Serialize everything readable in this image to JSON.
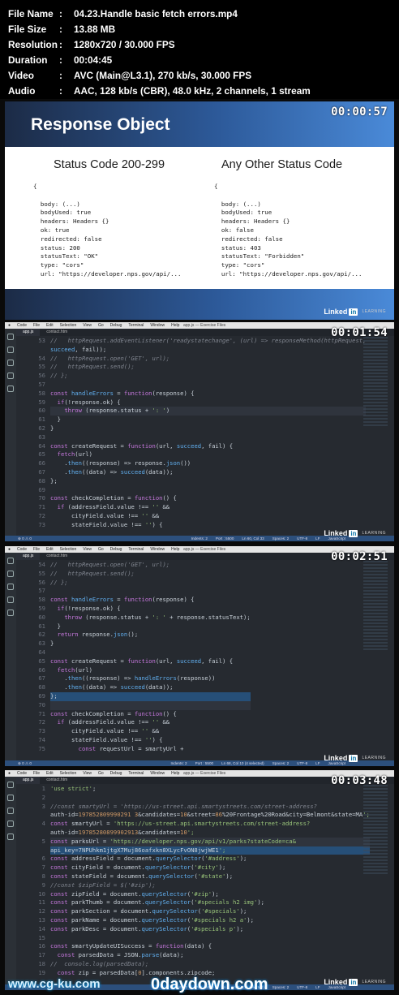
{
  "info": [
    {
      "label": "File Name",
      "value": "04.23.Handle basic fetch errors.mp4"
    },
    {
      "label": "File Size",
      "value": "13.88 MB"
    },
    {
      "label": "Resolution",
      "value": "1280x720 / 30.000 FPS"
    },
    {
      "label": "Duration",
      "value": "00:04:45"
    },
    {
      "label": "Video",
      "value": "AVC (Main@L3.1), 270 kb/s, 30.000 FPS"
    },
    {
      "label": "Audio",
      "value": "AAC, 128 kb/s (CBR), 48.0 kHz, 2 channels, 1 stream"
    }
  ],
  "colon": ":",
  "brand": {
    "linked": "Linked",
    "in": "in",
    "learning": "LEARNING"
  },
  "slide": {
    "timestamp": "00:00:57",
    "title": "Response Object",
    "left_heading": "Status Code 200-299",
    "right_heading": "Any Other Status Code",
    "left_code": "{\n\n  body: (...)\n  bodyUsed: true\n  headers: Headers {}\n  ok: true\n  redirected: false\n  status: 200\n  statusText: \"OK\"\n  type: \"cors\"\n  url: \"https://developer.nps.gov/api/...\n\n}",
    "right_code": "{\n\n  body: (...)\n  bodyUsed: true\n  headers: Headers {}\n  ok: false\n  redirected: false\n  status: 403\n  statusText: \"Forbidden\"\n  type: \"cors\"\n  url: \"https://developer.nps.gov/api/...\n\n}"
  },
  "editor": {
    "menu": [
      "Code",
      "File",
      "Edit",
      "Selection",
      "View",
      "Go",
      "Debug",
      "Terminal",
      "Window",
      "Help"
    ],
    "window_title": "app.js — Exercise Files",
    "tabs": [
      "app.js",
      "contact.htm"
    ]
  },
  "frames": [
    {
      "timestamp": "00:01:54",
      "lines": [
        {
          "n": "53",
          "t": "//   httpRequest.addEventListener('readystatechange', (url) => responseMethod(httpRequest,"
        },
        {
          "n": "",
          "t": "succeed, fail));"
        },
        {
          "n": "54",
          "t": "//   httpRequest.open('GET', url);"
        },
        {
          "n": "55",
          "t": "//   httpRequest.send();"
        },
        {
          "n": "56",
          "t": "// };"
        },
        {
          "n": "57",
          "t": ""
        },
        {
          "n": "58",
          "t": "const handleErrors = function(response) {"
        },
        {
          "n": "59",
          "t": "  if(!response.ok) {"
        },
        {
          "n": "60",
          "t": "    throw (response.status + ': ')"
        },
        {
          "n": "61",
          "t": "  }"
        },
        {
          "n": "62",
          "t": "}"
        },
        {
          "n": "63",
          "t": ""
        },
        {
          "n": "64",
          "t": "const createRequest = function(url, succeed, fail) {"
        },
        {
          "n": "65",
          "t": "  fetch(url)"
        },
        {
          "n": "66",
          "t": "    .then((response) => response.json())"
        },
        {
          "n": "67",
          "t": "    .then((data) => succeed(data));"
        },
        {
          "n": "68",
          "t": "};"
        },
        {
          "n": "69",
          "t": ""
        },
        {
          "n": "70",
          "t": "const checkCompletion = function() {"
        },
        {
          "n": "71",
          "t": "  if (addressField.value !== '' &&"
        },
        {
          "n": "72",
          "t": "      cityField.value !== '' &&"
        },
        {
          "n": "73",
          "t": "      stateField.value !== '') {"
        }
      ],
      "status_left": "⊗ 0 ⚠ 0",
      "status_right": [
        "Indents: 2",
        "Port : 5500",
        "Ln 60, Col 33",
        "Spaces: 2",
        "UTF-8",
        "LF",
        "JavaScript"
      ]
    },
    {
      "timestamp": "00:02:51",
      "lines": [
        {
          "n": "54",
          "t": "//   httpRequest.open('GET', url);"
        },
        {
          "n": "55",
          "t": "//   httpRequest.send();"
        },
        {
          "n": "56",
          "t": "// };"
        },
        {
          "n": "57",
          "t": ""
        },
        {
          "n": "58",
          "t": "const handleErrors = function(response) {"
        },
        {
          "n": "59",
          "t": "  if(!response.ok) {"
        },
        {
          "n": "60",
          "t": "    throw (response.status + ': ' + response.statusText);"
        },
        {
          "n": "61",
          "t": "  }"
        },
        {
          "n": "62",
          "t": "  return response.json();"
        },
        {
          "n": "63",
          "t": "}"
        },
        {
          "n": "64",
          "t": ""
        },
        {
          "n": "65",
          "t": "const createRequest = function(url, succeed, fail) {"
        },
        {
          "n": "66",
          "t": "  fetch(url)"
        },
        {
          "n": "67",
          "t": "    .then((response) => handleErrors(response))"
        },
        {
          "n": "68",
          "t": "    .then((data) => succeed(data));"
        },
        {
          "n": "69",
          "t": "};"
        },
        {
          "n": "70",
          "t": ""
        },
        {
          "n": "71",
          "t": "const checkCompletion = function() {"
        },
        {
          "n": "72",
          "t": "  if (addressField.value !== '' &&"
        },
        {
          "n": "73",
          "t": "      cityField.value !== '' &&"
        },
        {
          "n": "74",
          "t": "      stateField.value !== '') {"
        },
        {
          "n": "75",
          "t": "        const requestUrl = smartyUrl +"
        }
      ],
      "status_left": "⊗ 0 ⚠ 0",
      "status_right": [
        "Indents: 2",
        "Port : 5500",
        "Ln 68, Col 10 (4 selected)",
        "Spaces: 2",
        "UTF-8",
        "LF",
        "JavaScript"
      ]
    },
    {
      "timestamp": "00:03:48",
      "lines": [
        {
          "n": "1",
          "t": "'use strict';"
        },
        {
          "n": "2",
          "t": ""
        },
        {
          "n": "3",
          "t": "//const smartyUrl = 'https://us-street.api.smartystreets.com/street-address?"
        },
        {
          "n": "",
          "t": "auth-id=197852809990291 3&candidates=10&street=86%20Frontage%20Road&city=Belmont&state=MA';"
        },
        {
          "n": "4",
          "t": "const smartyUrl = 'https://us-street.api.smartystreets.com/street-address?"
        },
        {
          "n": "",
          "t": "auth-id=19785280899902913&candidates=10';"
        },
        {
          "n": "5",
          "t": "const parksUrl = 'https://developer.nps.gov/api/v1/parks?stateCode=ca&"
        },
        {
          "n": "",
          "t": "api_key=7NPUhkm1jtgX7Muj86oafxkn8XLycFvON8jwjWE1';"
        },
        {
          "n": "6",
          "t": "const addressField = document.querySelector('#address');"
        },
        {
          "n": "7",
          "t": "const cityField = document.querySelector('#city');"
        },
        {
          "n": "8",
          "t": "const stateField = document.querySelector('#state');"
        },
        {
          "n": "9",
          "t": "//const $zipField = $('#zip');"
        },
        {
          "n": "10",
          "t": "const zipField = document.querySelector('#zip');"
        },
        {
          "n": "11",
          "t": "const parkThumb = document.querySelector('#specials h2 img');"
        },
        {
          "n": "12",
          "t": "const parkSection = document.querySelector('#specials');"
        },
        {
          "n": "13",
          "t": "const parkName = document.querySelector('#specials h2 a');"
        },
        {
          "n": "14",
          "t": "const parkDesc = document.querySelector('#specials p');"
        },
        {
          "n": "15",
          "t": ""
        },
        {
          "n": "16",
          "t": "const smartyUpdateUISuccess = function(data) {"
        },
        {
          "n": "17",
          "t": "  const parsedData = JSON.parse(data);"
        },
        {
          "n": "18",
          "t": "//  console.log(parsedData);"
        },
        {
          "n": "19",
          "t": "  const zip = parsedData[0].components.zipcode;"
        }
      ],
      "status_left": "⊗ 0 ⚠ 0",
      "status_right": [
        "Indents: 2",
        "Port : 5500",
        "Ln 5, Col 5 (116 selected)",
        "Spaces: 2",
        "UTF-8",
        "LF",
        "JavaScript"
      ]
    }
  ],
  "watermark": {
    "left": "www.cg-ku.com",
    "right": "0daydown.com"
  }
}
